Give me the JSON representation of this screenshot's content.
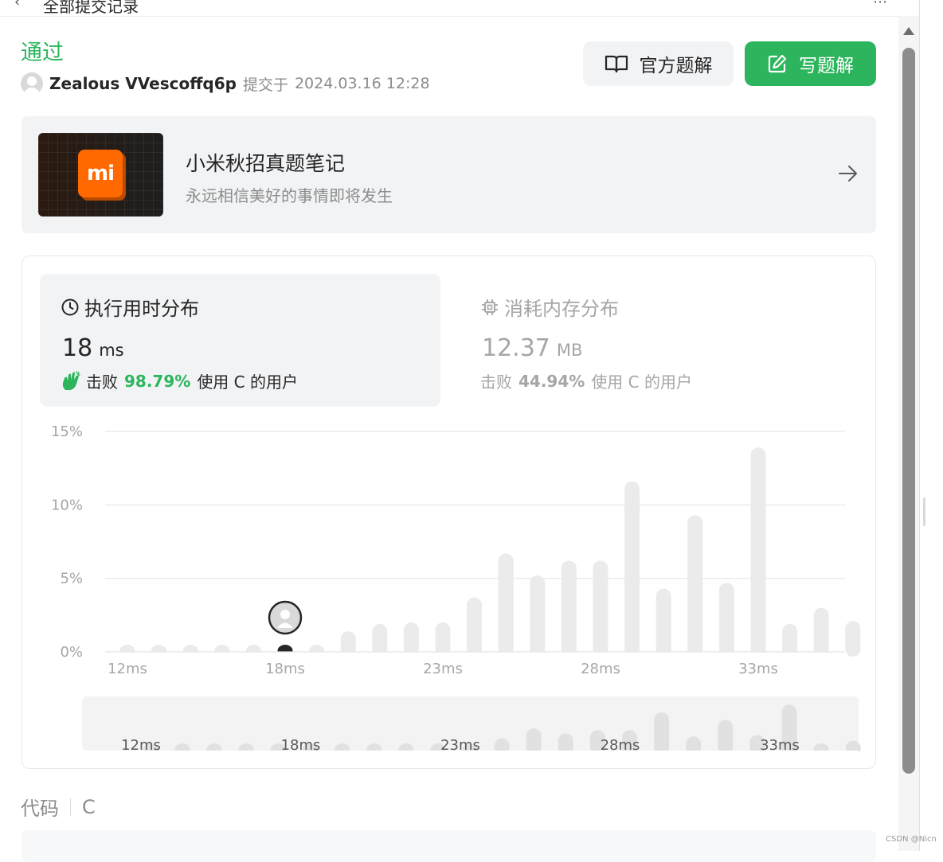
{
  "topbar": {
    "back_icon": "chevron-left-icon",
    "breadcrumb": "全部提交记录",
    "right_icon": "more-icon"
  },
  "submission": {
    "status": "通过",
    "username": "Zealous VVescoffq6p",
    "submitted_prefix": "提交于",
    "timestamp": "2024.03.16 12:28"
  },
  "actions": {
    "official_solution": "官方题解",
    "write_solution": "写题解"
  },
  "banner": {
    "title": "小米秋招真题笔记",
    "subtitle": "永远相信美好的事情即将发生",
    "logo_text": "mi"
  },
  "stats": {
    "runtime": {
      "title": "执行用时分布",
      "value": "18",
      "unit": "ms",
      "beat_label": "击败",
      "beat_pct": "98.79%",
      "beat_suffix": "使用 C 的用户"
    },
    "memory": {
      "title": "消耗内存分布",
      "value": "12.37",
      "unit": "MB",
      "beat_label": "击败",
      "beat_pct": "44.94%",
      "beat_suffix": "使用 C 的用户"
    }
  },
  "colors": {
    "accent": "#2db55d",
    "bar": "#ebebeb",
    "highlight_bar": "#262626"
  },
  "chart_data": {
    "type": "bar",
    "x": [
      12,
      13,
      14,
      15,
      16,
      17,
      18,
      19,
      20,
      21,
      22,
      23,
      24,
      25,
      26,
      27,
      28,
      29,
      30,
      31,
      32,
      33,
      34,
      35,
      36
    ],
    "values": [
      0.4,
      0.4,
      0.4,
      0.4,
      0.4,
      0.4,
      0.4,
      1.4,
      1.9,
      2.0,
      2.0,
      3.7,
      6.7,
      5.2,
      6.2,
      6.2,
      11.6,
      4.3,
      9.3,
      4.7,
      13.9,
      1.9,
      3.0,
      2.1,
      0
    ],
    "x_tick_labels": [
      "12ms",
      "18ms",
      "23ms",
      "28ms",
      "33ms"
    ],
    "x_tick_values": [
      12,
      17,
      22,
      27,
      32
    ],
    "y_tick_labels": [
      "0%",
      "5%",
      "10%",
      "15%"
    ],
    "y_tick_values": [
      0,
      5,
      10,
      15
    ],
    "ylim": [
      0,
      15
    ],
    "highlight_x": 17,
    "grid": true,
    "navigator": {
      "x_tick_labels": [
        "12ms",
        "18ms",
        "23ms",
        "28ms",
        "33ms"
      ]
    }
  },
  "code": {
    "label": "代码",
    "language": "C"
  },
  "watermark": "CSDN @Nicn"
}
